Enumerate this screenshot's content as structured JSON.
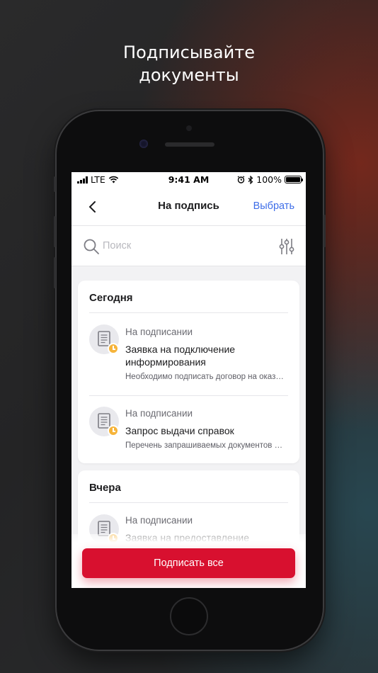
{
  "promo": {
    "headline_line1": "Подписывайте",
    "headline_line2": "документы"
  },
  "status_bar": {
    "carrier": "LTE",
    "time": "9:41 AM",
    "battery": "100%",
    "battery_level": 1.0
  },
  "nav": {
    "title": "На подпись",
    "action": "Выбрать"
  },
  "search": {
    "placeholder": "Поиск",
    "value": ""
  },
  "groups": [
    {
      "title": "Сегодня",
      "items": [
        {
          "status": "На подписании",
          "title": "Заявка на подключение информирования",
          "description": "Необходимо подписать договор на оказание услуг"
        },
        {
          "status": "На подписании",
          "title": "Запрос выдачи справок",
          "description": "Перечень запрашиваемых документов и справок"
        }
      ]
    },
    {
      "title": "Вчера",
      "items": [
        {
          "status": "На подписании",
          "title": "Заявка на предоставление",
          "description": ""
        }
      ]
    }
  ],
  "footer": {
    "sign_all_label": "Подписать все"
  },
  "colors": {
    "accent": "#d8102f",
    "link": "#3f6ee8",
    "pending": "#f6b43a"
  },
  "icons": [
    "back-chevron-icon",
    "search-icon",
    "filter-sliders-icon",
    "document-icon",
    "clock-icon",
    "wifi-icon",
    "alarm-icon",
    "bluetooth-icon",
    "battery-icon",
    "signal-bars-icon"
  ]
}
